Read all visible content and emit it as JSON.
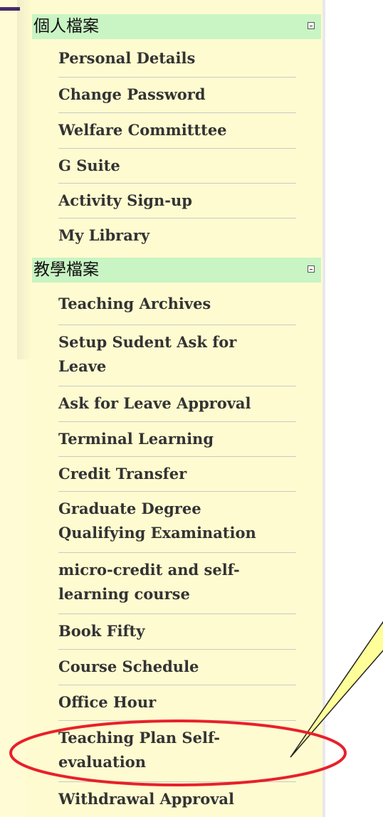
{
  "sections": [
    {
      "title": "個人檔案",
      "items": [
        "Personal Details",
        "Change Password",
        "Welfare Committtee",
        "G Suite",
        "Activity Sign-up",
        "My Library"
      ]
    },
    {
      "title": "教學檔案",
      "items": [
        "Teaching Archives",
        "Setup Sudent Ask for Leave",
        "Ask for Leave Approval",
        "Terminal Learning",
        "Credit Transfer",
        "Graduate Degree Qualifying Examination",
        "micro-credit and self-learning course",
        "Book Fifty",
        "Course Schedule",
        "Office Hour",
        "Teaching Plan Self-evaluation",
        "Withdrawal Approval"
      ]
    }
  ],
  "colors": {
    "section_header_bg": "#c9f4c3",
    "highlight_ellipse": "#e8202a",
    "callout_fill": "#ffff99"
  }
}
